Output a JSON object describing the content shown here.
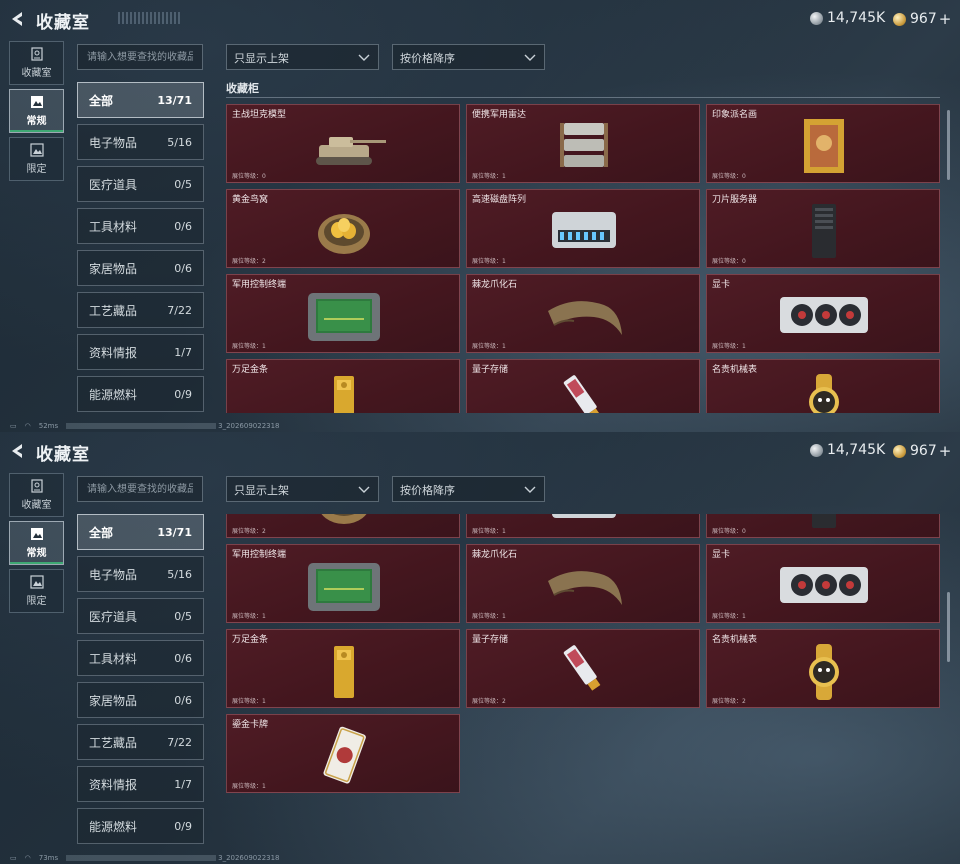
{
  "header": {
    "title": "收藏室"
  },
  "currency": {
    "silver": "14,745K",
    "gold": "967"
  },
  "leftnav": [
    {
      "label": "收藏室",
      "icon": "vault-icon"
    },
    {
      "label": "常规",
      "icon": "picture-icon"
    },
    {
      "label": "限定",
      "icon": "limited-picture-icon"
    }
  ],
  "search": {
    "placeholder": "请输入想要查找的收藏品"
  },
  "filters": {
    "shelf": "只显示上架",
    "sort": "按价格降序"
  },
  "categories": [
    {
      "label": "全部",
      "count": "13/71"
    },
    {
      "label": "电子物品",
      "count": "5/16"
    },
    {
      "label": "医疗道具",
      "count": "0/5"
    },
    {
      "label": "工具材料",
      "count": "0/6"
    },
    {
      "label": "家居物品",
      "count": "0/6"
    },
    {
      "label": "工艺藏品",
      "count": "7/22"
    },
    {
      "label": "资料情报",
      "count": "1/7"
    },
    {
      "label": "能源燃料",
      "count": "0/9"
    }
  ],
  "section": {
    "label": "收藏柜"
  },
  "level_prefix": "展位等级：",
  "items": [
    {
      "name": "主战坦克模型",
      "level": "0",
      "icon": "tank-model-icon"
    },
    {
      "name": "便携军用雷达",
      "level": "1",
      "icon": "radar-icon"
    },
    {
      "name": "印象派名画",
      "level": "0",
      "icon": "painting-icon"
    },
    {
      "name": "黄金鸟窝",
      "level": "2",
      "icon": "golden-nest-icon"
    },
    {
      "name": "高速磁盘阵列",
      "level": "1",
      "icon": "disk-array-icon"
    },
    {
      "name": "刀片服务器",
      "level": "0",
      "icon": "blade-server-icon"
    },
    {
      "name": "军用控制终端",
      "level": "1",
      "icon": "control-terminal-icon"
    },
    {
      "name": "棘龙爪化石",
      "level": "1",
      "icon": "claw-fossil-icon"
    },
    {
      "name": "显卡",
      "level": "1",
      "icon": "graphics-card-icon"
    },
    {
      "name": "万足金条",
      "level": "1",
      "icon": "gold-bar-icon"
    },
    {
      "name": "量子存储",
      "level": "2",
      "icon": "quantum-storage-icon"
    },
    {
      "name": "名贵机械表",
      "level": "2",
      "icon": "luxury-watch-icon"
    },
    {
      "name": "鎏金卡牌",
      "level": "1",
      "icon": "gilded-card-icon"
    }
  ],
  "status": [
    {
      "ping": "52ms",
      "build": "3_202609022318"
    },
    {
      "ping": "73ms",
      "build": "3_202609022318"
    }
  ],
  "colors": {
    "card_bg": "#4a1a22",
    "active_accent": "#3ea873"
  }
}
